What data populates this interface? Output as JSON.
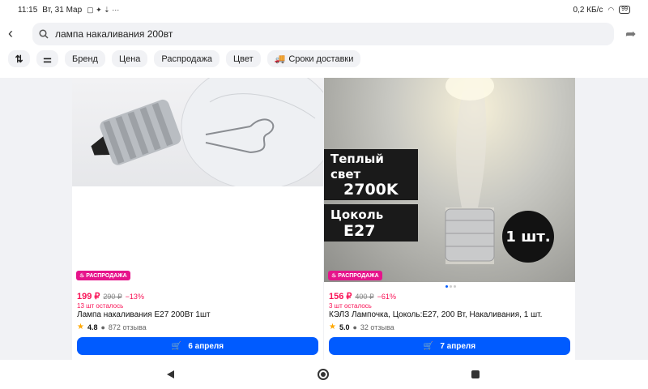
{
  "status": {
    "time": "11:15",
    "date": "Вт, 31 Мар",
    "net": "0,2 КБ/с",
    "battery": "99"
  },
  "search": {
    "query": "лампа накаливания 200вт"
  },
  "filters": {
    "chips": [
      "Бренд",
      "Цена",
      "Распродажа",
      "Цвет",
      "Сроки доставки"
    ]
  },
  "products": [
    {
      "badge": "РАСПРОДАЖА",
      "price": "199 ₽",
      "old_price": "290 ₽",
      "discount": "−13%",
      "stock": "13 шт осталось",
      "title": "Лампа накаливания E27 200Вт 1шт",
      "rating": "4.8",
      "reviews": "872 отзыва",
      "delivery": "6 апреля"
    },
    {
      "badge": "РАСПРОДАЖА",
      "price": "156 ₽",
      "old_price": "400 ₽",
      "discount": "−61%",
      "stock": "3 шт осталось",
      "title": "КЭЛЗ Лампочка, Цоколь:E27, 200 Вт, Накаливания, 1 шт.",
      "rating": "5.0",
      "reviews": "32 отзыва",
      "delivery": "7 апреля",
      "image_text": {
        "l1": "Теплый свет",
        "l2": "2700K",
        "l3": "Цоколь",
        "l4": "E27",
        "qty": "1 шт."
      }
    }
  ],
  "colors": {
    "accent": "#005bff",
    "sale": "#f91155",
    "badge": "#e6148b"
  }
}
